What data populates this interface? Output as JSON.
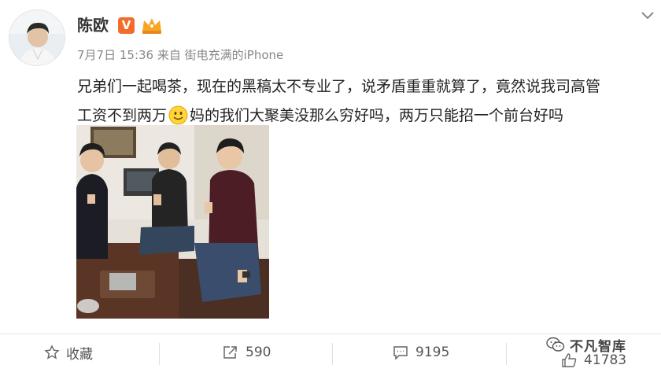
{
  "post": {
    "author_name": "陈欧",
    "verified_badge": "V",
    "timestamp": "7月7日 15:36",
    "source": "来自 街电充满的iPhone",
    "text_line1": "兄弟们一起喝茶，现在的黑稿太不专业了，说矛盾重重就算了，竟然说我司高管",
    "text_line2_before": "工资不到两万",
    "text_line2_after": "妈的我们大聚美没那么穷好吗，两万只能招一个前台好吗",
    "emoji_icon": "smile-emoji-icon"
  },
  "actions": {
    "favorite_label": "收藏",
    "repost_count": "590",
    "comment_count": "9195",
    "like_count": "41783"
  },
  "watermark": {
    "text": "不凡智库"
  },
  "colors": {
    "verified_orange": "#f26d2b",
    "text_dark": "#222222",
    "text_meta": "#888888",
    "action_gray": "#555555"
  }
}
